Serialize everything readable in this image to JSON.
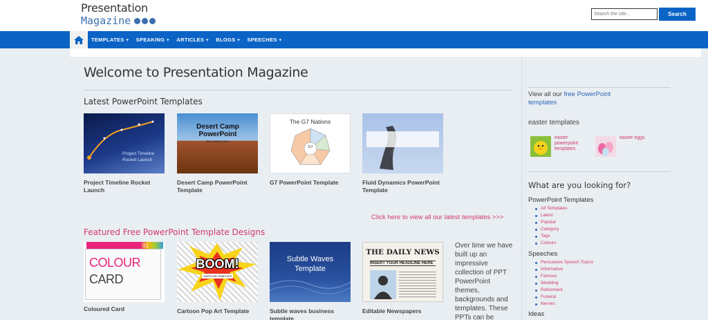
{
  "header": {
    "logo_line1": "Presentation",
    "logo_line2": "Magazine",
    "search_placeholder": "Search the site...",
    "search_button": "Search"
  },
  "nav": {
    "items": [
      "TEMPLATES +",
      "SPEAKING +",
      "ARTICLES +",
      "BLOGS +",
      "SPEECHES +"
    ]
  },
  "main": {
    "title": "Welcome to Presentation Magazine",
    "latest_heading": "Latest PowerPoint Templates",
    "latest": [
      {
        "caption": "Project Timeline Rocket Launch",
        "thumb_text": "Project Timeline Rocket Launch"
      },
      {
        "caption": "Desert Camp PowerPoint Template",
        "thumb_title": "Desert Camp PowerPoint",
        "thumb_sub": "Your Name Here"
      },
      {
        "caption": "G7 PowerPoint Template",
        "thumb_title": "The G7 Nations",
        "center": "G7"
      },
      {
        "caption": "Fluid Dynamics PowerPoint Template"
      }
    ],
    "view_all": "Click here to view all our latest templates >>>",
    "featured_heading": "Featured Free PowerPoint Template Designs",
    "featured": [
      {
        "caption": "Coloured Card",
        "num": "01",
        "word1": "COLOUR",
        "word2": "CARD"
      },
      {
        "caption": "Cartoon Pop Art Template",
        "word": "BOOM!",
        "sub": "CARTOON TEMPLATE"
      },
      {
        "caption": "Subtle waves business template",
        "thumb_title": "Subtle Waves Template"
      },
      {
        "caption": "Editable Newspapers",
        "masthead": "THE DAILY NEWS",
        "headline": "INSERT YOUR HEADLINE HERE"
      }
    ],
    "over_text": "Over time we have built up an impressive collection of PPT PowerPoint themes, backgrounds and templates. These PPTs can be"
  },
  "sidebar": {
    "view_all_prefix": "View all our ",
    "view_all_link": "free PowerPoint templates",
    "easter_heading": "easter templates",
    "easter_items": [
      "easter powerpoint templates",
      "easter eggs"
    ],
    "looking_heading": "What are you looking for?",
    "groups": [
      {
        "title": "PowerPoint Templates",
        "items": [
          "All Templates",
          "Latest",
          "Popular",
          "Category",
          "Tags",
          "Colours"
        ]
      },
      {
        "title": "Speeches",
        "items": [
          "Persuasive Speech Topics",
          "Informative",
          "Famous",
          "Wedding",
          "Retirement",
          "Funeral",
          "Nerves"
        ]
      },
      {
        "title": "Ideas",
        "items": []
      }
    ]
  },
  "colors": {
    "accent": "#0b63c5",
    "link_pink": "#d03a67",
    "link_blue": "#2a66b5"
  }
}
